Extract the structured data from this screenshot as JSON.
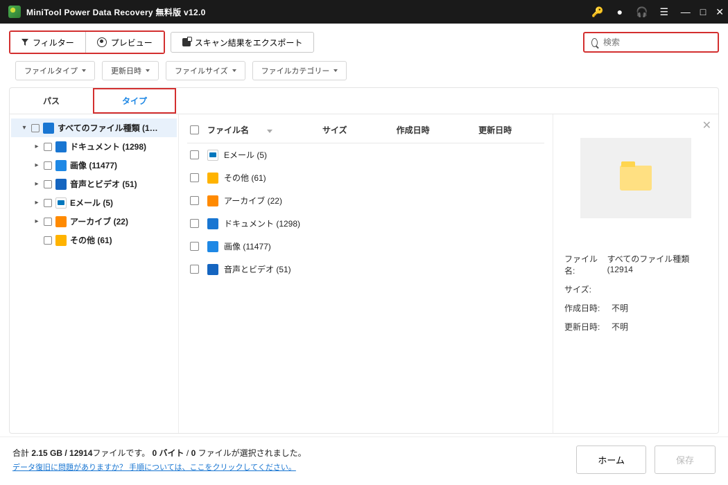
{
  "titlebar": {
    "title": "MiniTool Power Data Recovery 無料版 v12.0"
  },
  "toolbar": {
    "filter": "フィルター",
    "preview": "プレビュー",
    "export": "スキャン結果をエクスポート"
  },
  "search": {
    "placeholder": "検索"
  },
  "filters": {
    "fileType": "ファイルタイプ",
    "updateDate": "更新日時",
    "fileSize": "ファイルサイズ",
    "fileCategory": "ファイルカテゴリー"
  },
  "viewTabs": {
    "path": "パス",
    "type": "タイプ"
  },
  "tree": {
    "root": "すべてのファイル種類 (1…",
    "items": [
      {
        "label": "ドキュメント (1298)",
        "icon": "doc"
      },
      {
        "label": "画像 (11477)",
        "icon": "img"
      },
      {
        "label": "音声とビデオ (51)",
        "icon": "av"
      },
      {
        "label": "Eメール (5)",
        "icon": "email"
      },
      {
        "label": "アーカイブ (22)",
        "icon": "archive"
      },
      {
        "label": "その他 (61)",
        "icon": "other",
        "noCaret": true
      }
    ]
  },
  "listHeader": {
    "name": "ファイル名",
    "size": "サイズ",
    "created": "作成日時",
    "updated": "更新日時"
  },
  "listRows": [
    {
      "label": "Eメール (5)",
      "icon": "email"
    },
    {
      "label": "その他 (61)",
      "icon": "other"
    },
    {
      "label": "アーカイブ (22)",
      "icon": "archive"
    },
    {
      "label": "ドキュメント (1298)",
      "icon": "doc"
    },
    {
      "label": "画像 (11477)",
      "icon": "img"
    },
    {
      "label": "音声とビデオ (51)",
      "icon": "av"
    }
  ],
  "detail": {
    "labels": {
      "name": "ファイル名:",
      "size": "サイズ:",
      "created": "作成日時:",
      "updated": "更新日時:"
    },
    "name": "すべてのファイル種類 (12914",
    "size": "",
    "created": "不明",
    "updated": "不明"
  },
  "footer": {
    "line1_a": "合計 ",
    "line1_b": "2.15 GB / 12914",
    "line1_c": "ファイルです。 ",
    "line1_d": "0 バイト",
    "line1_e": "  /  ",
    "line1_f": "0 ",
    "line1_g": "ファイルが選択されました。",
    "link": "データ復旧に問題がありますか？ 手順については、ここをクリックしてください。",
    "home": "ホーム",
    "save": "保存"
  }
}
